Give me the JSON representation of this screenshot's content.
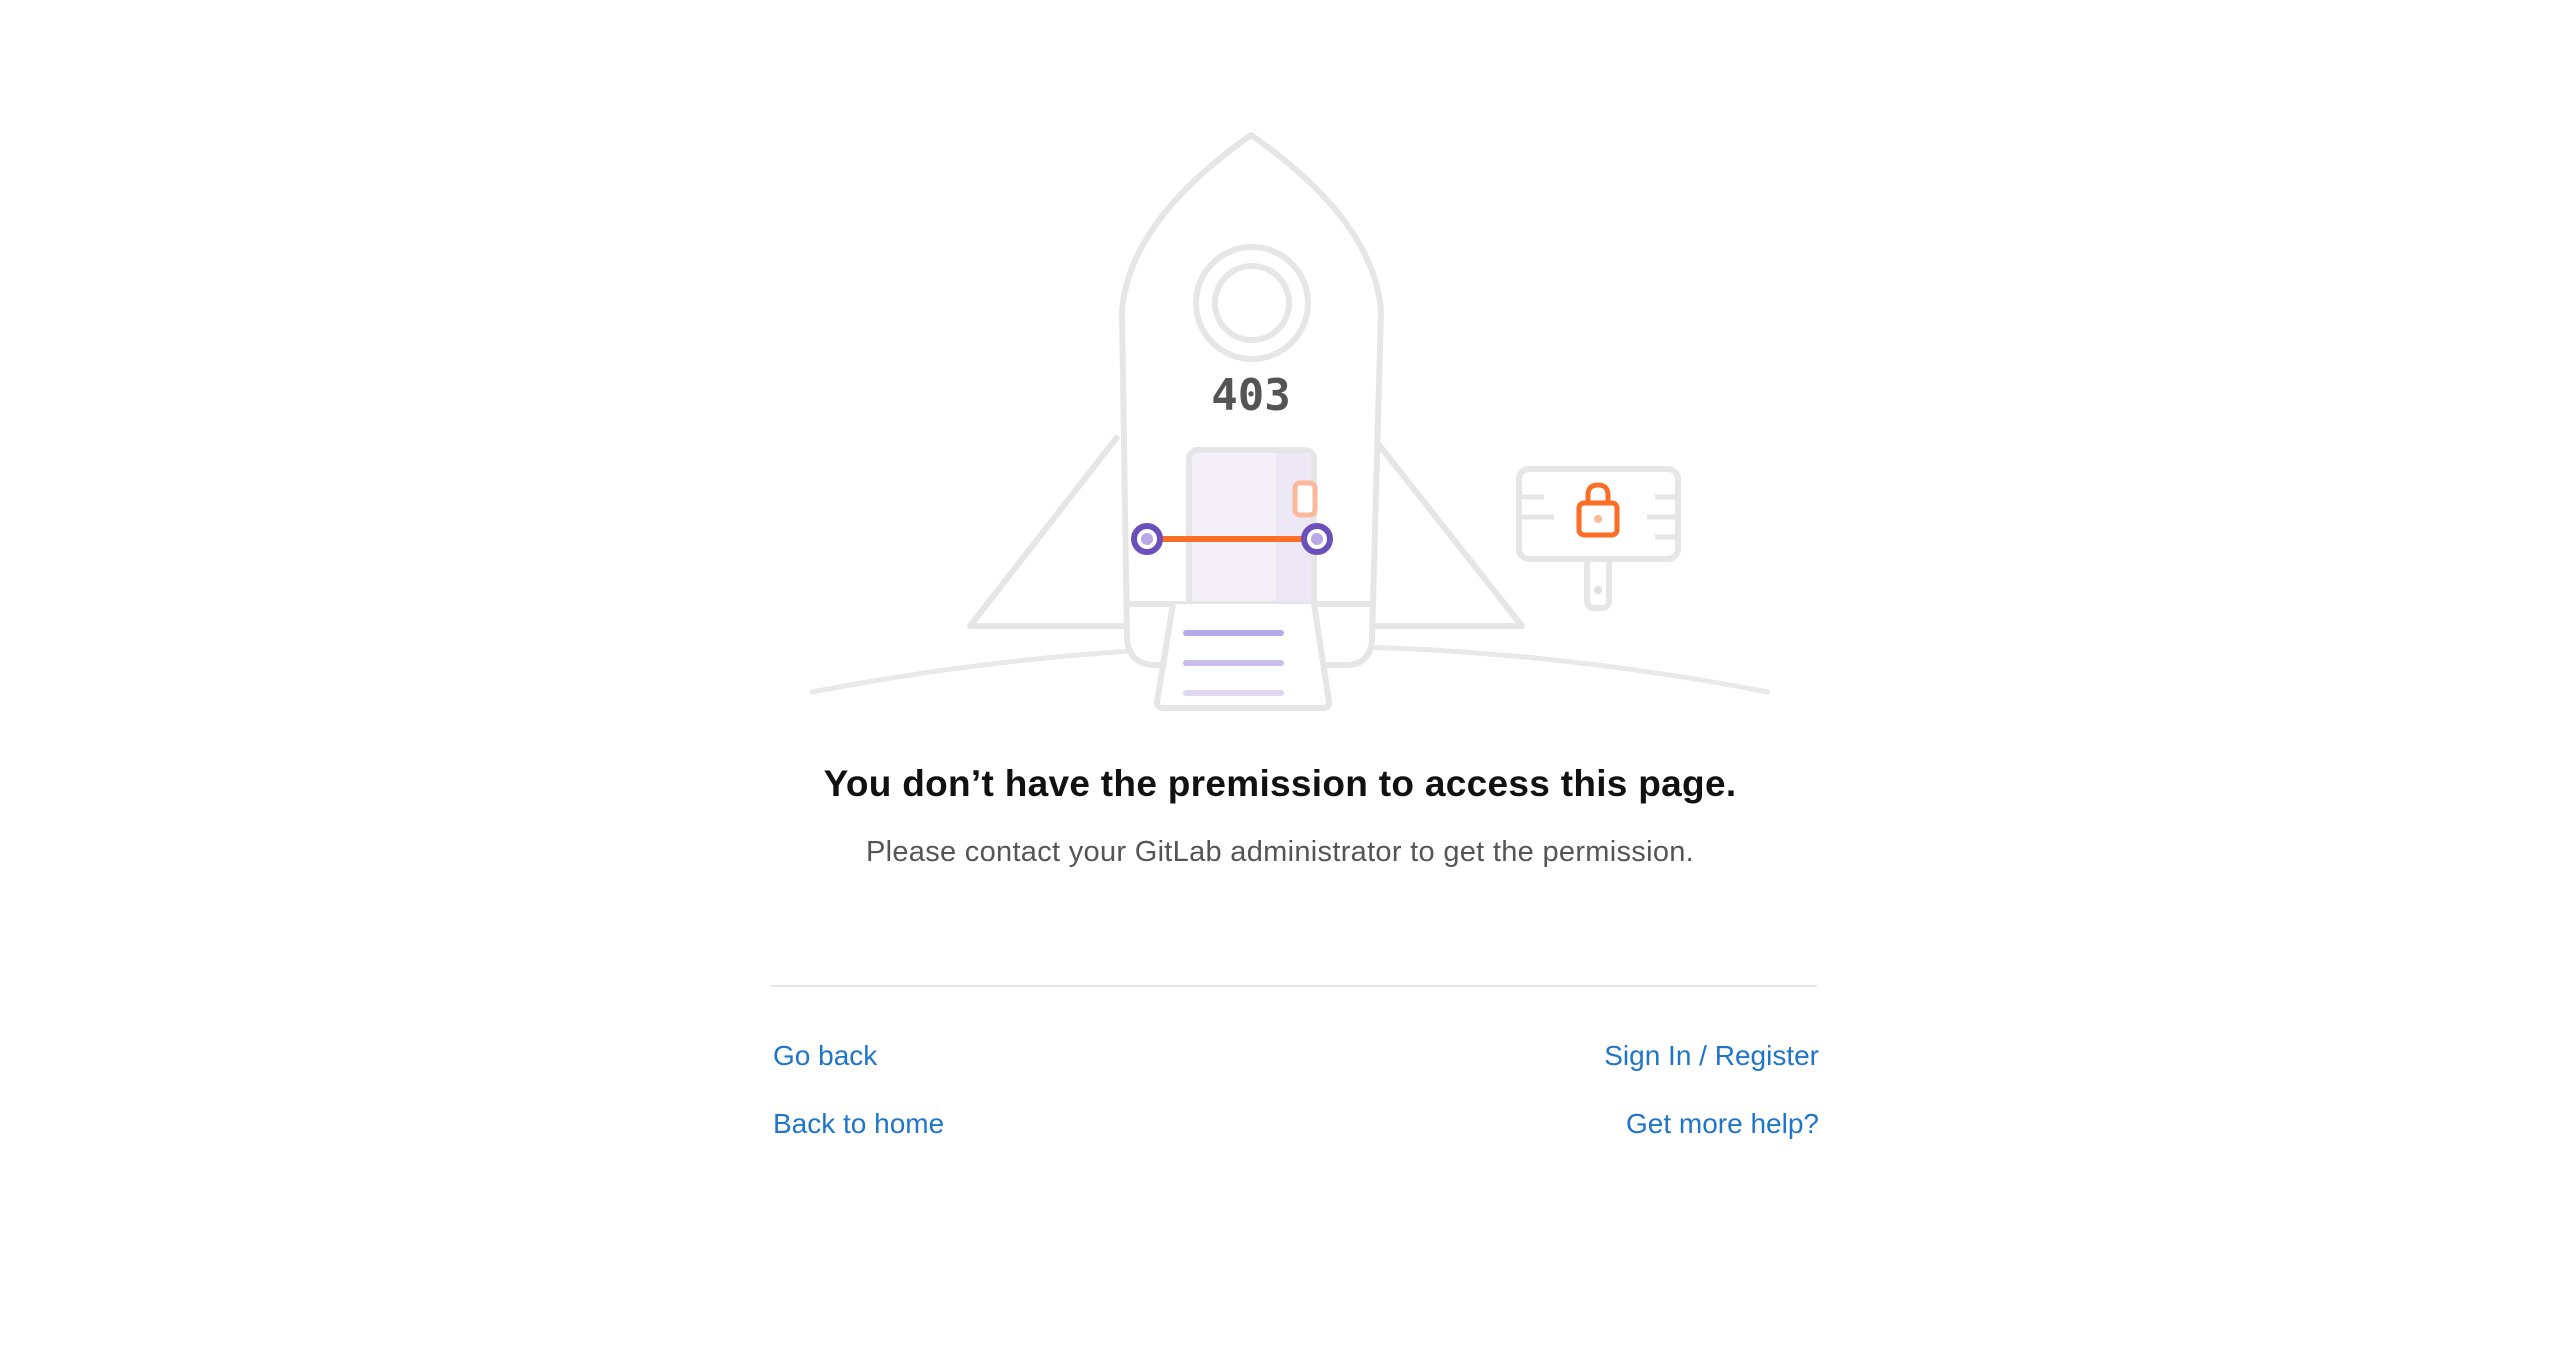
{
  "illustration": {
    "code": "403"
  },
  "message": {
    "title": "You don’t have the premission to access this page.",
    "subtitle": "Please contact your GitLab administrator to get the permission."
  },
  "links": {
    "go_back": "Go back",
    "back_to_home": "Back to home",
    "sign_in_register": "Sign In / Register",
    "get_more_help": "Get more help?"
  },
  "colors": {
    "outline": "#e6e6e6",
    "accent_orange": "#fc6d26",
    "accent_purple": "#6b4fbb",
    "link": "#1f75cb"
  }
}
